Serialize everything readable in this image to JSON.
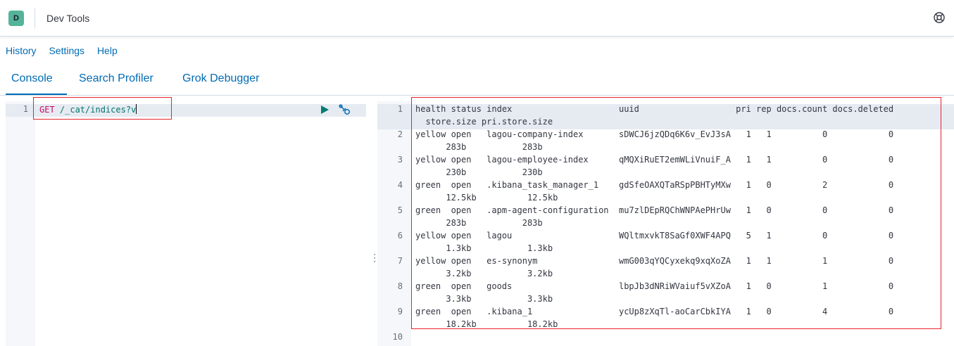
{
  "header": {
    "avatar_letter": "D",
    "app_title": "Dev Tools",
    "help_icon": "help-lifebuoy-icon"
  },
  "menu": {
    "history": "History",
    "settings": "Settings",
    "help": "Help"
  },
  "tabs": [
    {
      "label": "Console",
      "active": true
    },
    {
      "label": "Search Profiler",
      "active": false
    },
    {
      "label": "Grok Debugger",
      "active": false
    }
  ],
  "editor": {
    "line_numbers": [
      "1"
    ],
    "request_method": "GET",
    "request_path": " /_cat/indices?v",
    "run_icon": "play-icon",
    "settings_icon": "wrench-icon"
  },
  "output": {
    "line_numbers": [
      "1",
      "2",
      "3",
      "4",
      "5",
      "6",
      "7",
      "8",
      "9",
      "10"
    ],
    "lines": [
      "health status index                     uuid                   pri rep docs.count docs.deleted\n  store.size pri.store.size",
      "yellow open   lagou-company-index       sDWCJ6jzQDq6K6v_EvJ3sA   1   1          0            0\n      283b           283b",
      "yellow open   lagou-employee-index      qMQXiRuET2emWLiVnuiF_A   1   1          0            0\n      230b           230b",
      "green  open   .kibana_task_manager_1    gdSfeOAXQTaRSpPBHTyMXw   1   0          2            0\n      12.5kb          12.5kb",
      "green  open   .apm-agent-configuration  mu7zlDEpRQChWNPAePHrUw   1   0          0            0\n      283b           283b",
      "yellow open   lagou                     WQltmxvkT8SaGf0XWF4APQ   5   1          0            0\n      1.3kb           1.3kb",
      "yellow open   es-synonym                wmG003qYQCyxekq9xqXoZA   1   1          1            0\n      3.2kb           3.2kb",
      "green  open   goods                     lbpJb3dNRiWVaiuf5vXZoA   1   0          1            0\n      3.3kb           3.3kb",
      "green  open   .kibana_1                 ycUp8zXqTl-aoCarCbkIYA   1   0          4            0\n      18.2kb          18.2kb",
      ""
    ]
  }
}
